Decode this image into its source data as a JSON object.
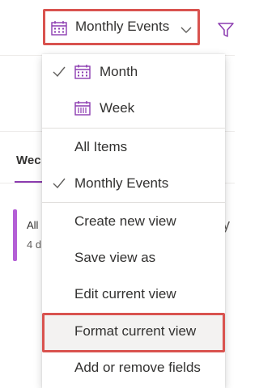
{
  "header": {
    "view_selector_label": "Monthly Events",
    "icons": {
      "view_icon": "calendar-icon",
      "chevron": "chevron-down-icon",
      "filter": "filter-icon"
    }
  },
  "background": {
    "tab_label": "Wec",
    "card_line1": "All",
    "card_line2": "4 d",
    "right_glyph": "y"
  },
  "menu": {
    "layout_items": [
      {
        "label": "Month",
        "checked": true,
        "icon": "calendar-month-icon"
      },
      {
        "label": "Week",
        "checked": false,
        "icon": "calendar-week-icon"
      }
    ],
    "view_items": [
      {
        "label": "All Items",
        "checked": false
      },
      {
        "label": "Monthly Events",
        "checked": true
      }
    ],
    "action_items": [
      {
        "label": "Create new view"
      },
      {
        "label": "Save view as"
      },
      {
        "label": "Edit current view"
      },
      {
        "label": "Format current view"
      },
      {
        "label": "Add or remove fields"
      }
    ]
  },
  "colors": {
    "accent_purple": "#8c3cb0",
    "highlight_red": "#d9534f",
    "text": "#323130"
  }
}
